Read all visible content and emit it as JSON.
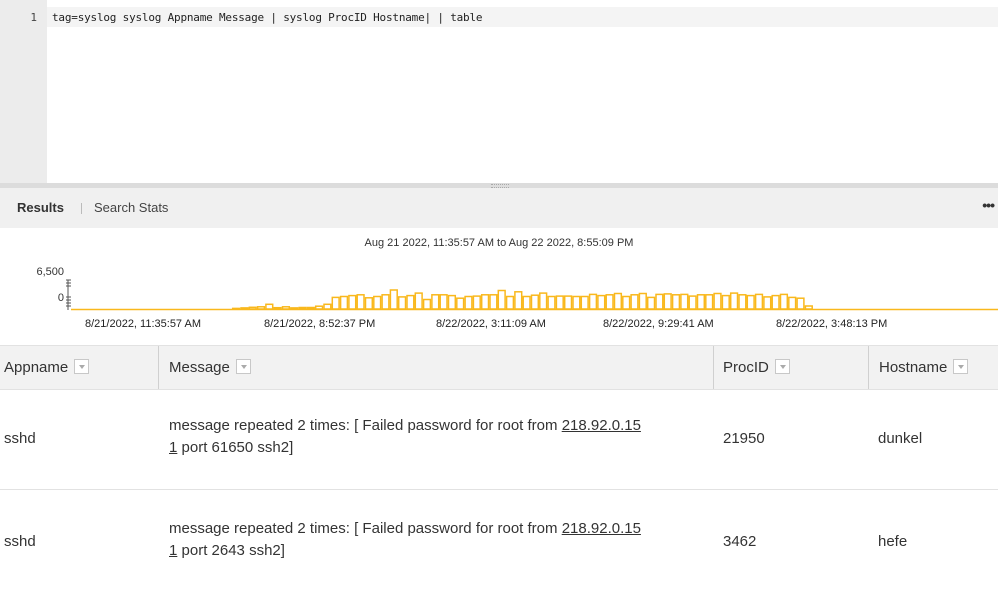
{
  "editor": {
    "line_number": "1",
    "query": "tag=syslog syslog Appname Message | syslog ProcID Hostname| | table"
  },
  "tabs": {
    "results": "Results",
    "search_stats": "Search Stats",
    "more": "•••"
  },
  "chart": {
    "time_range": "Aug 21 2022, 11:35:57 AM to Aug 22 2022, 8:55:09 PM",
    "y_ticks": [
      "6,500",
      "0"
    ],
    "x_ticks": [
      "8/21/2022, 11:35:57 AM",
      "8/21/2022, 8:52:37 PM",
      "8/22/2022, 3:11:09 AM",
      "8/22/2022, 9:29:41 AM",
      "8/22/2022, 3:48:13 PM"
    ],
    "bar_color": "#f9b81c"
  },
  "chart_data": {
    "type": "bar",
    "title": "Aug 21 2022, 11:35:57 AM to Aug 22 2022, 8:55:09 PM",
    "ylim": [
      0,
      6500
    ],
    "grid": false,
    "values": [
      0,
      0,
      0,
      0,
      0,
      0,
      0,
      0,
      0,
      0,
      0,
      0,
      0,
      0,
      0,
      0,
      0,
      0,
      0,
      150,
      250,
      400,
      500,
      1100,
      300,
      500,
      250,
      350,
      350,
      650,
      1100,
      2700,
      2900,
      3100,
      3300,
      2600,
      2900,
      3300,
      4400,
      2800,
      3100,
      3700,
      2200,
      3300,
      3300,
      3100,
      2500,
      2900,
      3000,
      3300,
      3300,
      4300,
      2900,
      4000,
      2900,
      3200,
      3700,
      2900,
      3000,
      3000,
      2900,
      2900,
      3400,
      3100,
      3300,
      3600,
      2900,
      3300,
      3600,
      2700,
      3400,
      3500,
      3300,
      3400,
      3000,
      3300,
      3300,
      3600,
      3100,
      3700,
      3300,
      3100,
      3400,
      2800,
      3100,
      3400,
      2700,
      2500,
      700,
      0,
      0,
      0,
      0,
      0,
      0,
      0,
      0,
      0,
      0,
      0,
      0,
      0,
      0,
      0,
      0,
      0,
      0,
      0,
      0,
      0,
      0,
      0
    ]
  },
  "table": {
    "columns": [
      "Appname",
      "Message",
      "ProcID",
      "Hostname"
    ],
    "rows": [
      {
        "appname": "sshd",
        "msg_pre": "message repeated 2 times: [ Failed password for root from ",
        "ip_a": "218.92.0.15",
        "ip_b": "1",
        "msg_post": " port 61650 ssh2]",
        "procid": "21950",
        "hostname": "dunkel"
      },
      {
        "appname": "sshd",
        "msg_pre": "message repeated 2 times: [ Failed password for root from ",
        "ip_a": "218.92.0.15",
        "ip_b": "1",
        "msg_post": " port 2643 ssh2]",
        "procid": "3462",
        "hostname": "hefe"
      }
    ]
  }
}
